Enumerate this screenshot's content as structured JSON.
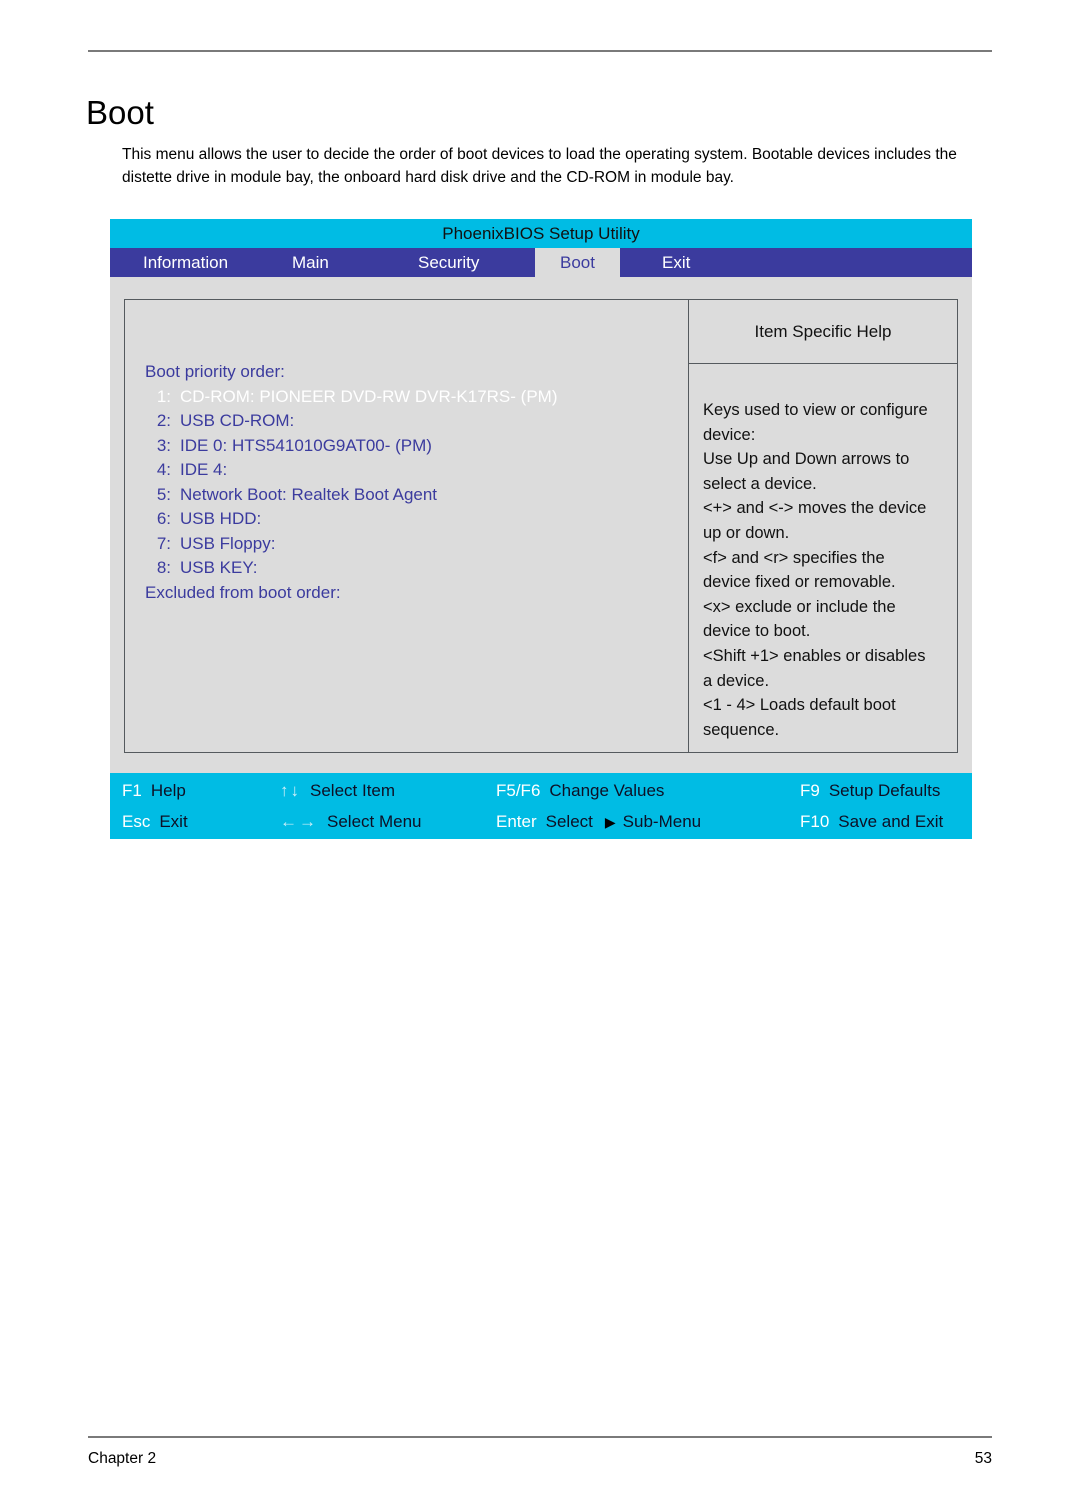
{
  "document": {
    "heading": "Boot",
    "intro": "This menu allows the user to decide the order of boot devices to load the operating system. Bootable devices includes the distette drive in module bay, the onboard hard disk drive and the CD-ROM in module bay.",
    "footer_left": "Chapter 2",
    "footer_right": "53"
  },
  "bios": {
    "title": "PhoenixBIOS Setup Utility",
    "tabs": [
      {
        "label": "Information",
        "active": false
      },
      {
        "label": "Main",
        "active": false
      },
      {
        "label": "Security",
        "active": false
      },
      {
        "label": "Boot",
        "active": true
      },
      {
        "label": "Exit",
        "active": false
      }
    ],
    "boot": {
      "priority_label": "Boot priority order:",
      "items": [
        {
          "num": "1:",
          "text": "CD-ROM: PIONEER DVD-RW DVR-K17RS- (PM)",
          "selected": true
        },
        {
          "num": "2:",
          "text": "USB CD-ROM:",
          "selected": false
        },
        {
          "num": "3:",
          "text": "IDE 0: HTS541010G9AT00- (PM)",
          "selected": false
        },
        {
          "num": "4:",
          "text": "IDE 4:",
          "selected": false
        },
        {
          "num": "5:",
          "text": "Network Boot: Realtek Boot Agent",
          "selected": false
        },
        {
          "num": "6:",
          "text": "USB HDD:",
          "selected": false
        },
        {
          "num": "7:",
          "text": "USB Floppy:",
          "selected": false
        },
        {
          "num": "8:",
          "text": "USB KEY:",
          "selected": false
        }
      ],
      "excluded_label": "Excluded from boot order:"
    },
    "help": {
      "title": "Item Specific Help",
      "lines": [
        "Keys used to view or configure",
        "device:",
        "Use Up and Down arrows to",
        "select a device.",
        "<+> and <-> moves the device",
        "up or down.",
        "<f> and <r> specifies the",
        "device fixed or removable.",
        "<x> exclude or include the",
        "device to boot.",
        "<Shift +1> enables or disables",
        "a device.",
        "<1 - 4> Loads default boot",
        "sequence."
      ]
    },
    "function_keys": {
      "row1": [
        {
          "key": "F1",
          "desc": "Help"
        },
        {
          "key": "↑↓",
          "desc": "Select Item",
          "arrows": true
        },
        {
          "key": "F5/F6",
          "desc": "Change Values"
        },
        {
          "key": "F9",
          "desc": "Setup Defaults"
        }
      ],
      "row2": [
        {
          "key": "Esc",
          "desc": "Exit"
        },
        {
          "key": "←→",
          "desc": "Select Menu",
          "arrows": true
        },
        {
          "key": "Enter",
          "desc": "Select",
          "submenu": "Sub-Menu",
          "submenu_arrow": "▶"
        },
        {
          "key": "F10",
          "desc": "Save and Exit"
        }
      ]
    }
  },
  "colors": {
    "cyan": "#00BCE4",
    "tabbar_blue": "#3B3B9E",
    "panel_gray": "#DCDCDC",
    "text_blue": "#3B3B9E",
    "selected_text": "#FFFFFF"
  }
}
